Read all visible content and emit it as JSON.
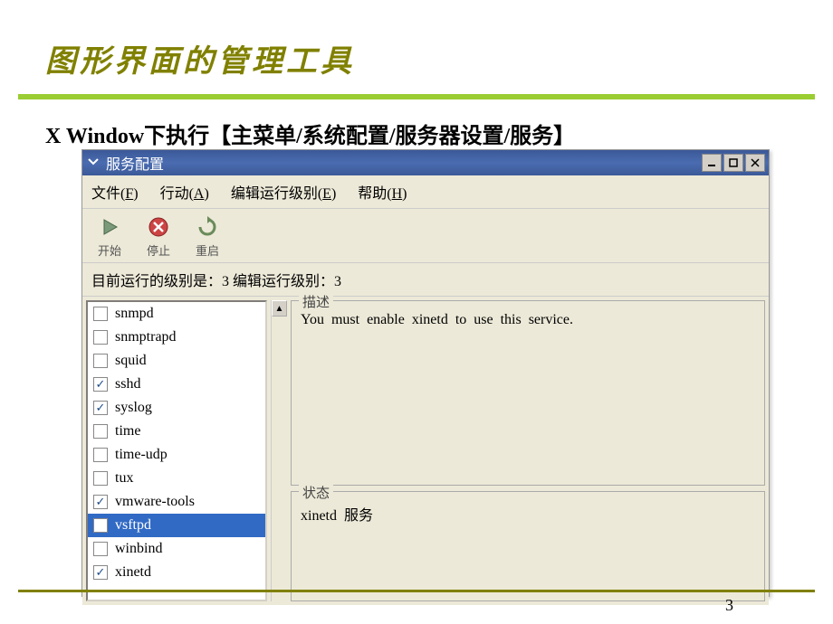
{
  "slide": {
    "title": "图形界面的管理工具",
    "subtitle": "X Window下执行【主菜单/系统配置/服务器设置/服务】",
    "pageNum": "3"
  },
  "window": {
    "title": "服务配置"
  },
  "menubar": [
    {
      "label": "文件",
      "accel": "F"
    },
    {
      "label": "行动",
      "accel": "A"
    },
    {
      "label": "编辑运行级别",
      "accel": "E"
    },
    {
      "label": "帮助",
      "accel": "H"
    }
  ],
  "toolbar": [
    {
      "name": "start",
      "label": "开始"
    },
    {
      "name": "stop",
      "label": "停止"
    },
    {
      "name": "restart",
      "label": "重启"
    }
  ],
  "statusLine": "目前运行的级别是：3  编辑运行级别：3",
  "services": [
    {
      "name": "snmpd",
      "checked": false,
      "selected": false
    },
    {
      "name": "snmptrapd",
      "checked": false,
      "selected": false
    },
    {
      "name": "squid",
      "checked": false,
      "selected": false
    },
    {
      "name": "sshd",
      "checked": true,
      "selected": false
    },
    {
      "name": "syslog",
      "checked": true,
      "selected": false
    },
    {
      "name": "time",
      "checked": false,
      "selected": false
    },
    {
      "name": "time-udp",
      "checked": false,
      "selected": false
    },
    {
      "name": "tux",
      "checked": false,
      "selected": false
    },
    {
      "name": "vmware-tools",
      "checked": true,
      "selected": false
    },
    {
      "name": "vsftpd",
      "checked": false,
      "selected": true
    },
    {
      "name": "winbind",
      "checked": false,
      "selected": false
    },
    {
      "name": "xinetd",
      "checked": true,
      "selected": false
    }
  ],
  "panels": {
    "descTitle": "描述",
    "descContent": "You must enable xinetd to use this service.",
    "statusTitle": "状态",
    "statusContent": "xinetd 服务"
  }
}
